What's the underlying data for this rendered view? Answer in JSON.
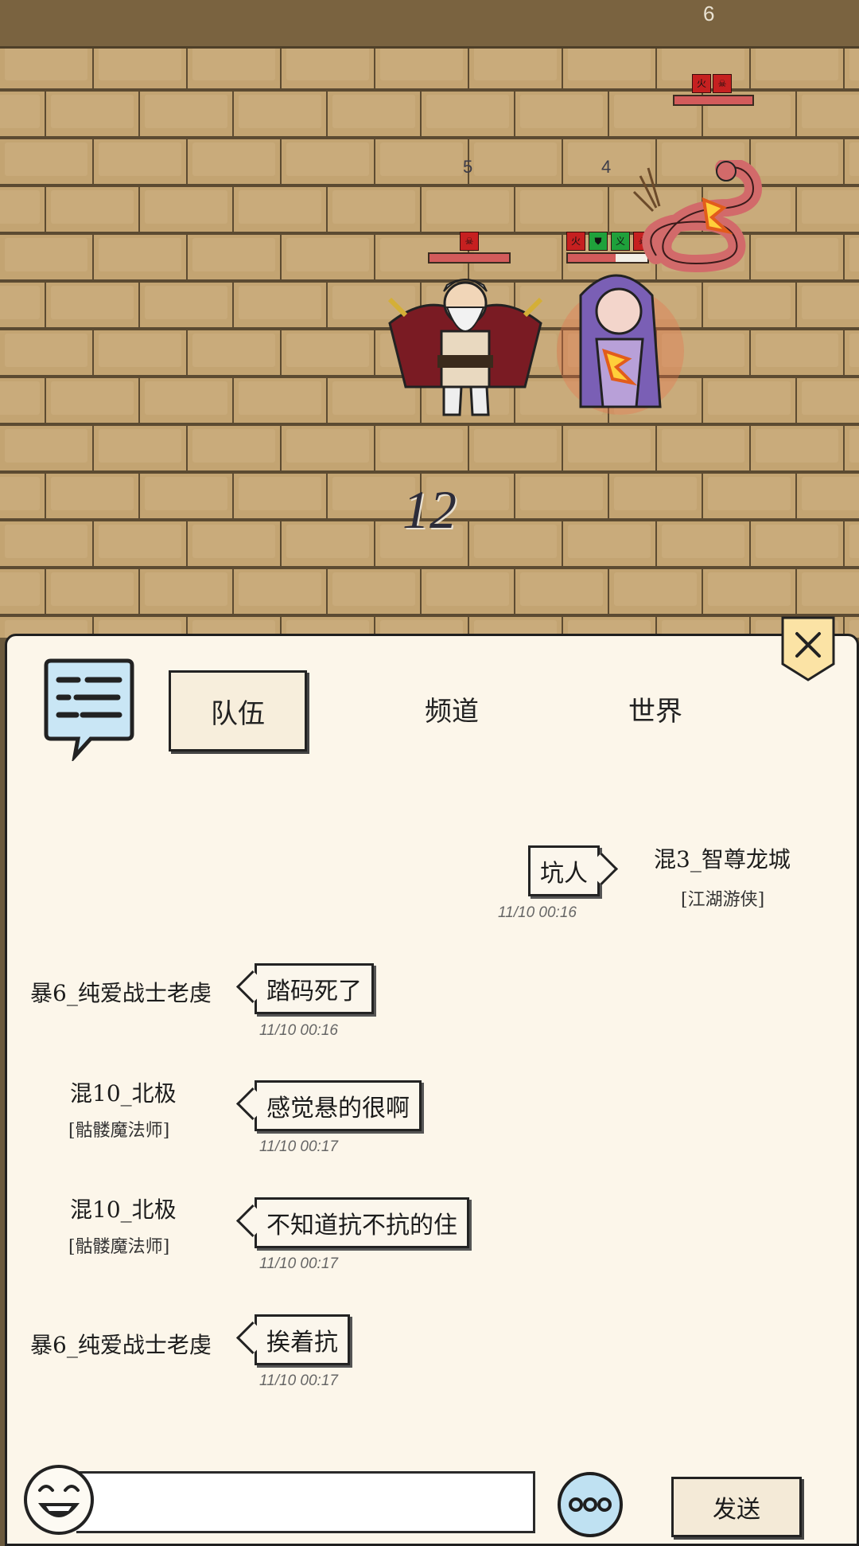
{
  "battle": {
    "wave_number": "6",
    "position_labels": [
      "5",
      "4"
    ],
    "damage_number": "12",
    "buff_icons": {
      "top_right_unit": [
        "火",
        "☠"
      ],
      "mid_left_unit": [
        "☠"
      ],
      "mid_right_unit": [
        "火",
        "⛊",
        "义",
        "☠"
      ]
    },
    "colors": {
      "hp_fill": "#d35b5b",
      "debuff_red": "#c62020",
      "buff_green": "#1fa13b"
    }
  },
  "chat": {
    "tabs": [
      {
        "label": "队伍",
        "active": true
      },
      {
        "label": "频道",
        "active": false
      },
      {
        "label": "世界",
        "active": false
      }
    ],
    "messages": [
      {
        "side": "right",
        "name": "混3_智尊龙城",
        "title": "[江湖游侠]",
        "text": "坑人",
        "time": "11/10 00:16"
      },
      {
        "side": "left",
        "name": "暴6_纯爱战士老虔",
        "title": "",
        "text": "踏码死了",
        "time": "11/10 00:16"
      },
      {
        "side": "left",
        "name": "混10_北极",
        "title": "[骷髅魔法师]",
        "text": "感觉悬的很啊",
        "time": "11/10 00:17"
      },
      {
        "side": "left",
        "name": "混10_北极",
        "title": "[骷髅魔法师]",
        "text": "不知道抗不抗的住",
        "time": "11/10 00:17"
      },
      {
        "side": "left",
        "name": "暴6_纯爱战士老虔",
        "title": "",
        "text": "挨着抗",
        "time": "11/10 00:17"
      }
    ],
    "input": {
      "value": "",
      "placeholder": ""
    },
    "send_label": "发送",
    "icons": {
      "close": "close-icon",
      "chat": "chat-bubble-icon",
      "emoji": "laughing-face-icon",
      "more": "more-dots-icon"
    }
  }
}
